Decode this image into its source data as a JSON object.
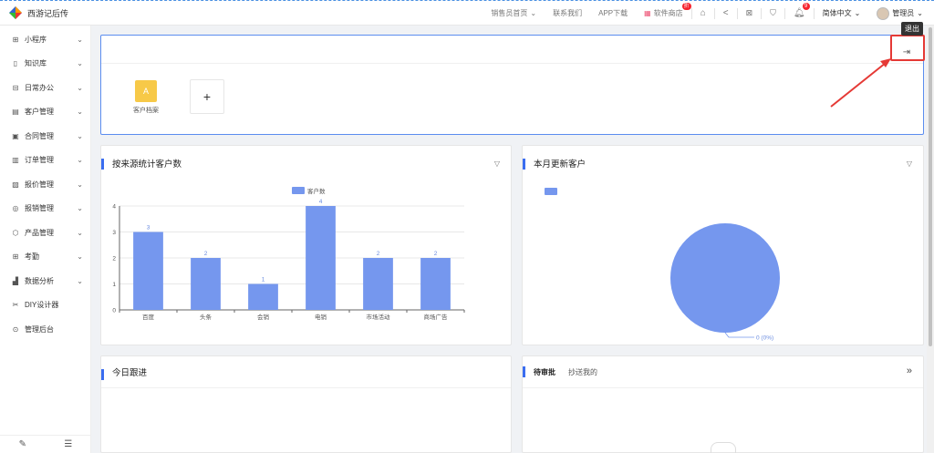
{
  "app": {
    "title": "西游记后传",
    "accent": "#3a6df0",
    "logo_icon": "diamond-logo-icon"
  },
  "topnav": {
    "items": [
      {
        "label": "销售员首页",
        "dropdown": true
      },
      {
        "label": "联系我们"
      },
      {
        "label": "APP下载"
      },
      {
        "label": "软件商店",
        "badge": "折"
      }
    ],
    "icons": [
      "home-icon",
      "share-icon",
      "screen-icon",
      "shirt-icon",
      "bell-icon"
    ],
    "bell_badge": "9",
    "language": "简体中文",
    "user": "管理员"
  },
  "sidebar": {
    "items": [
      {
        "label": "小程序",
        "icon": "grid-icon",
        "expandable": true
      },
      {
        "label": "知识库",
        "icon": "book-icon",
        "expandable": true
      },
      {
        "label": "日常办公",
        "icon": "briefcase-icon",
        "expandable": true
      },
      {
        "label": "客户管理",
        "icon": "customer-icon",
        "expandable": true
      },
      {
        "label": "合同管理",
        "icon": "contract-icon",
        "expandable": true
      },
      {
        "label": "订单管理",
        "icon": "order-icon",
        "expandable": true
      },
      {
        "label": "报价管理",
        "icon": "quote-icon",
        "expandable": true
      },
      {
        "label": "报销管理",
        "icon": "reimburse-icon",
        "expandable": true
      },
      {
        "label": "产品管理",
        "icon": "product-icon",
        "expandable": true
      },
      {
        "label": "考勤",
        "icon": "attendance-icon",
        "expandable": true
      },
      {
        "label": "数据分析",
        "icon": "analytics-icon",
        "expandable": true
      },
      {
        "label": "DIY设计器",
        "icon": "tools-icon",
        "expandable": false
      },
      {
        "label": "管理后台",
        "icon": "settings-icon",
        "expandable": false
      }
    ]
  },
  "shortcuts": {
    "tile_letter": "A",
    "tile_label": "客户档案",
    "add_label": "+",
    "logout_tooltip": "退出"
  },
  "source_chart": {
    "title": "按来源统计客户数"
  },
  "pie_chart": {
    "title": "本月更新客户",
    "label": "0 (0%)"
  },
  "follow_card": {
    "title": "今日跟进"
  },
  "approval_card": {
    "tab_active": "待审批",
    "tab_inactive": "抄送我的"
  },
  "chart_data": [
    {
      "type": "bar",
      "title": "按来源统计客户数",
      "categories": [
        "百度",
        "头条",
        "会销",
        "电销",
        "市场活动",
        "商场广告"
      ],
      "series": [
        {
          "name": "客户数",
          "values": [
            3,
            2,
            1,
            4,
            2,
            2
          ]
        }
      ],
      "ylim": [
        0,
        4
      ],
      "yticks": [
        0,
        1,
        2,
        3,
        4
      ],
      "grid": true,
      "legend": "top-center",
      "color": "#7597ee"
    },
    {
      "type": "pie",
      "title": "本月更新客户",
      "slices": [
        {
          "label": "",
          "value": 0
        }
      ],
      "data_label": "0 (0%)",
      "legend": "top-left",
      "color": "#7597ee"
    }
  ]
}
